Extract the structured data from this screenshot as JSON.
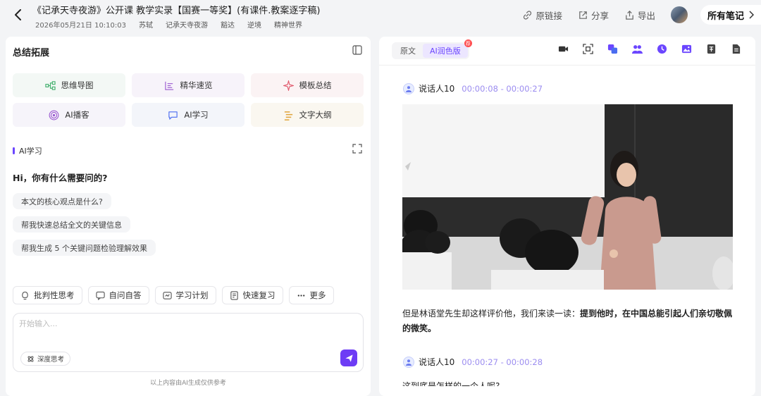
{
  "header": {
    "title": "《记承天寺夜游》公开课 教学实录【国赛一等奖】(有课件.教案逐字稿)",
    "date": "2026年05月21日 10:10:03",
    "tags": [
      "苏轼",
      "记承天寺夜游",
      "豁达",
      "逆境",
      "精神世界"
    ],
    "actions": {
      "link": "原链接",
      "share": "分享",
      "export": "导出",
      "all_notes": "所有笔记"
    }
  },
  "left": {
    "title": "总结拓展",
    "grid": [
      {
        "label": "思维导图",
        "icon": "mindmap-icon",
        "color": "#3fae6b"
      },
      {
        "label": "精华速览",
        "icon": "list-icon",
        "color": "#9b59d0"
      },
      {
        "label": "模板总结",
        "icon": "sparkle-icon",
        "color": "#e0566a"
      },
      {
        "label": "AI播客",
        "icon": "podcast-icon",
        "color": "#9b59d0"
      },
      {
        "label": "AI学习",
        "icon": "chat-icon",
        "color": "#4a6cf0"
      },
      {
        "label": "文字大纲",
        "icon": "outline-icon",
        "color": "#e0a43a"
      }
    ],
    "ai_section": "AI学习",
    "greeting": "Hi，你有什么需要问的?",
    "suggestions": [
      "本文的核心观点是什么?",
      "帮我快速总结全文的关键信息",
      "帮我生成 5 个关键问题检验理解效果"
    ],
    "tools": [
      "批判性思考",
      "自问自答",
      "学习计划",
      "快速复习",
      "更多"
    ],
    "input_placeholder": "开始输入...",
    "deep_think": "深度思考",
    "disclaimer": "以上内容由AI生成仅供参考"
  },
  "right": {
    "tabs": [
      "原文",
      "AI润色版"
    ],
    "badge": "荐",
    "entries": [
      {
        "speaker": "说话人10",
        "time": "00:00:08 - 00:00:27"
      },
      {
        "speaker": "说话人10",
        "time": "00:00:27 - 00:00:28"
      }
    ],
    "paragraph_plain": "但是林语堂先生却这样评价他，我们来读一读：",
    "paragraph_bold": "提到他时，在中国总能引起人们亲切敬佩的微笑。",
    "cut_text": "这到底是怎样的一个人呢?"
  },
  "colors": {
    "accent": "#6d3cf5",
    "time": "#9b8cf0"
  }
}
